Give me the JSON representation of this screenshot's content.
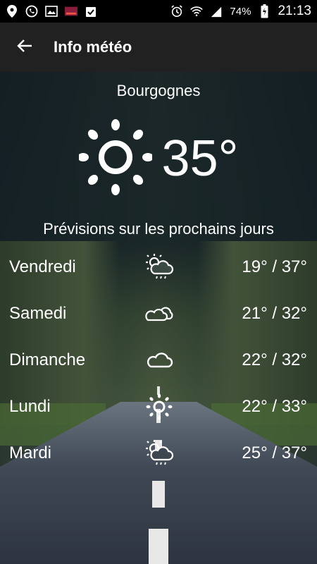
{
  "status_bar": {
    "battery": "74%",
    "time": "21:13"
  },
  "app_bar": {
    "title": "Info météo"
  },
  "current": {
    "location": "Bourgognes",
    "temperature": "35°",
    "condition_icon": "sun-icon"
  },
  "forecast": {
    "title": "Prévisions sur les prochains jours",
    "days": [
      {
        "day": "Vendredi",
        "temps": "19° / 37°",
        "icon": "sun-cloud-rain-icon"
      },
      {
        "day": "Samedi",
        "temps": "21° / 32°",
        "icon": "clouds-icon"
      },
      {
        "day": "Dimanche",
        "temps": "22° / 32°",
        "icon": "cloud-icon"
      },
      {
        "day": "Lundi",
        "temps": "22° / 33°",
        "icon": "sun-icon"
      },
      {
        "day": "Mardi",
        "temps": "25° / 37°",
        "icon": "sun-cloud-rain-icon"
      }
    ]
  }
}
